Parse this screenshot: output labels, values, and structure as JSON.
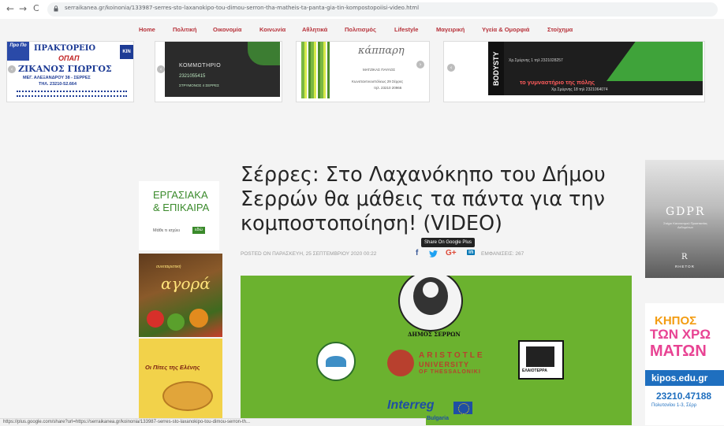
{
  "browser": {
    "url": "serraikanea.gr/koinonia/133987-serres-sto-laxanokipo-tou-dimou-serron-tha-matheis-ta-panta-gia-tin-kompostopoiisi-video.html",
    "back": "←",
    "forward": "→",
    "reload": "C"
  },
  "menu": {
    "items": [
      "Home",
      "Πολιτική",
      "Οικονομία",
      "Κοινωνία",
      "Αθλητικά",
      "Πολιτισμός",
      "Lifestyle",
      "Μαγειρική",
      "Υγεία & Ομορφιά",
      "Στοίχημα"
    ]
  },
  "ads": {
    "ad1": {
      "badge": "Προ Πο",
      "line1": "ΠΡΑΚΤΟΡΕΙΟ",
      "line2": "ΟΠΑΠ",
      "name": "ΖΙΚΑΝΟΣ ΓΙΩΡΓΟΣ",
      "address": "ΜΕΓ. ΑΛΕΞΑΝΔΡΟΥ 38 - ΣΕΡΡΕΣ",
      "phone": "ΤΗΛ. 23210-52.664",
      "side": "KIN"
    },
    "ad2": {
      "title": "ΚΟΜΜΩΤΗΡΙΟ",
      "phone": "2321055415",
      "address": "ΣΤΡΥΜΟΝΟΣ 4 ΣΕΡΡΕΣ"
    },
    "ad3": {
      "brand": "κάππαρη",
      "name": "ΜΑΤΖΙΚΑΣ ΠΑΥΛΟΣ",
      "address": "Κωνσταντινουπόλεως 29 Σέρρες",
      "phone": "τηλ. 23210 20966"
    },
    "ad4": {
      "vertical": "BODYSTY",
      "line1": "το γυμναστήριο της πόλης",
      "line2": "Χρ.Σμύρνης 18 τηλ 2321064074",
      "line0": "Χρ.Σμύρνης 1 τηλ 2321028257"
    }
  },
  "article": {
    "title": "Σέρρες: Στο Λαχανόκηπο του Δήμου Σερρών θα μάθεις τα πάντα για την κομποστοποίηση! (VIDEO)",
    "meta": "POSTED ON ΠΑΡΑΣΚΕΥΗ, 25 ΣΕΠΤΕΜΒΡΙΟΥ 2020 00:22",
    "views": "ΕΜΦΑΝΙΣΕΙΣ: 267",
    "tooltip": "Share On Google Plus",
    "social": {
      "facebook": "f",
      "twitter": "🐦",
      "gplus": "G+",
      "linkedin": "in"
    }
  },
  "video": {
    "logo_top": "ΔΗΜΟΣ ΣΕΡΡΩΝ",
    "auth1": "ARISTOTLE",
    "auth2": "UNIVERSITY",
    "auth3": "OF THESSALONIKI",
    "right_label": "ΕΛΑΙΟΤΕΡΡΑ",
    "interreg": "Interreg",
    "interreg_sub": "Bulgaria"
  },
  "left_sidebar": {
    "label1": "ΕΡΓΑΣΙΑΚΑ",
    "label2": "& ΕΠΙΚΑΙΡΑ",
    "learn": "Μάθε τι ισχύει",
    "click": "εδώ",
    "market": "αγορά",
    "pies": "Οι Πίτες της Ελένης"
  },
  "right_sidebar": {
    "gdpr": "GDPR",
    "gdpr_sub": "Στόχοι Κανονισμού Προστασίας Δεδομένων",
    "publisher": "RHETOR",
    "kipos1": "ΚΗΠΟΣ",
    "kipos2": "ΤΩΝ ΧΡΩ",
    "kipos3": "ΜΑΤΩΝ",
    "site": "kipos.edu.gr",
    "phone": "23210.47188",
    "address": "Πολυτονίου 1-3, Σέρρ"
  },
  "status": {
    "text": "https://plus.google.com/share?url=https://serraikanea.gr/koinonia/133987-serres-sto-laxanokipo-tou-dimou-serron-th..."
  },
  "colors": {
    "menu_link": "#b7323a",
    "video_bg": "#6bb22f",
    "facebook": "#3b5998",
    "twitter": "#1da1f2",
    "gplus": "#dd4b39",
    "linkedin": "#0077b5"
  }
}
